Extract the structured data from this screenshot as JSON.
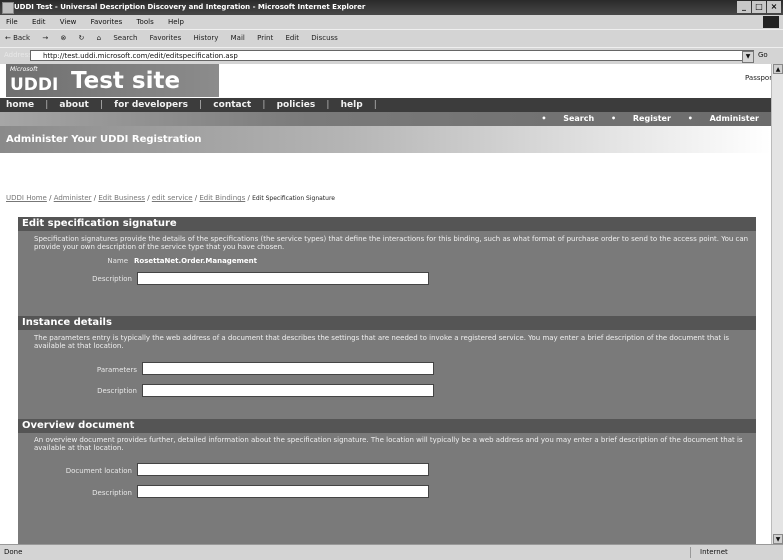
{
  "browser": {
    "title": "UDDI Test - Universal Description Discovery and Integration - Microsoft Internet Explorer",
    "window_buttons": [
      "_",
      "□",
      "×"
    ],
    "menu": [
      "File",
      "Edit",
      "View",
      "Favorites",
      "Tools",
      "Help"
    ],
    "toolbar": [
      "← Back",
      "→",
      "⊗",
      "↻",
      "⌂",
      "Search",
      "Favorites",
      "History",
      "Mail",
      "Print",
      "Edit",
      "Discuss"
    ],
    "address_label": "Address",
    "address_url": "http://test.uddi.microsoft.com/edit/editspecification.asp",
    "go_label": "Go",
    "status_left": "Done",
    "status_right": "Internet"
  },
  "site": {
    "logo_ms": "Microsoft",
    "logo_uddi": "UDDI",
    "logo_title": "Test site",
    "passport": "Passport",
    "nav": [
      "home",
      "about",
      "for developers",
      "contact",
      "policies",
      "help"
    ],
    "subnav": [
      "Search",
      "Register",
      "Administer"
    ],
    "banner": "Administer Your UDDI Registration",
    "breadcrumbs": [
      "UDDI Home",
      "Administer",
      "Edit Business",
      "edit service",
      "Edit Bindings"
    ],
    "breadcrumb_current": "Edit Specification Signature"
  },
  "form": {
    "sig_title": "Edit specification signature",
    "sig_desc": "Specification signatures provide the details of the specifications (the service types) that define the interactions for this binding, such as what format of purchase order to send to the access point. You can provide your own description of the service type that you have chosen.",
    "name_label": "Name",
    "name_value": "RosettaNet.Order.Management",
    "description_label": "Description",
    "inst_title": "Instance details",
    "inst_desc": "The parameters entry is typically the web address of a document that describes the settings that are needed to invoke a registered service. You may enter a brief description of the document that is available at that location.",
    "parameters_label": "Parameters",
    "inst_desc_label": "Description",
    "ov_title": "Overview document",
    "ov_desc": "An overview document provides further, detailed information about the specification signature. The location will typically be a web address and you may enter a brief description of the document that is available at that location.",
    "doc_location_label": "Document location",
    "ov_desc_label": "Description"
  }
}
